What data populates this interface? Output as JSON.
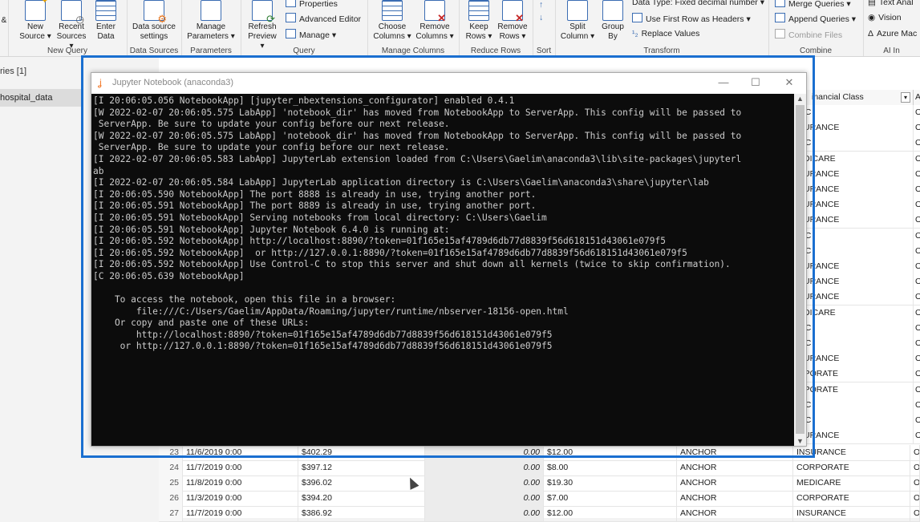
{
  "ribbon": {
    "groups": [
      {
        "label": "New Query",
        "buttons": [
          "New Source",
          "Recent Sources",
          "Enter Data"
        ]
      },
      {
        "label": "Data Sources",
        "buttons": [
          "Data source settings"
        ]
      },
      {
        "label": "Parameters",
        "buttons": [
          "Manage Parameters"
        ]
      },
      {
        "label": "Query",
        "buttons": [
          "Refresh Preview"
        ],
        "small": [
          "Properties",
          "Advanced Editor",
          "Manage"
        ]
      },
      {
        "label": "Manage Columns",
        "buttons": [
          "Choose Columns",
          "Remove Columns"
        ]
      },
      {
        "label": "Reduce Rows",
        "buttons": [
          "Keep Rows",
          "Remove Rows"
        ]
      },
      {
        "label": "Sort",
        "buttons": []
      },
      {
        "label": "Transform",
        "buttons": [
          "Split Column",
          "Group By"
        ],
        "small": [
          "Data Type: Fixed decimal number",
          "Use First Row as Headers",
          "Replace Values"
        ]
      },
      {
        "label": "Combine",
        "small": [
          "Merge Queries",
          "Append Queries",
          "Combine Files"
        ]
      },
      {
        "label": "AI In",
        "small": [
          "Text Anal",
          "Vision",
          "Azure Mac"
        ]
      }
    ],
    "edge_label": "&"
  },
  "queries": {
    "header": "ries [1]",
    "item": "hospital_data"
  },
  "window": {
    "title": "Jupyter Notebook (anaconda3)",
    "console": "[I 20:06:05.056 NotebookApp] [jupyter_nbextensions_configurator] enabled 0.4.1\n[W 2022-02-07 20:06:05.575 LabApp] 'notebook_dir' has moved from NotebookApp to ServerApp. This config will be passed to\n ServerApp. Be sure to update your config before our next release.\n[W 2022-02-07 20:06:05.575 LabApp] 'notebook_dir' has moved from NotebookApp to ServerApp. This config will be passed to\n ServerApp. Be sure to update your config before our next release.\n[I 2022-02-07 20:06:05.583 LabApp] JupyterLab extension loaded from C:\\Users\\Gaelim\\anaconda3\\lib\\site-packages\\jupyterl\nab\n[I 2022-02-07 20:06:05.584 LabApp] JupyterLab application directory is C:\\Users\\Gaelim\\anaconda3\\share\\jupyter\\lab\n[I 20:06:05.590 NotebookApp] The port 8888 is already in use, trying another port.\n[I 20:06:05.591 NotebookApp] The port 8889 is already in use, trying another port.\n[I 20:06:05.591 NotebookApp] Serving notebooks from local directory: C:\\Users\\Gaelim\n[I 20:06:05.591 NotebookApp] Jupyter Notebook 6.4.0 is running at:\n[I 20:06:05.592 NotebookApp] http://localhost:8890/?token=01f165e15af4789d6db77d8839f56d618151d43061e079f5\n[I 20:06:05.592 NotebookApp]  or http://127.0.0.1:8890/?token=01f165e15af4789d6db77d8839f56d618151d43061e079f5\n[I 20:06:05.592 NotebookApp] Use Control-C to stop this server and shut down all kernels (twice to skip confirmation).\n[C 20:06:05.639 NotebookApp]\n\n    To access the notebook, open this file in a browser:\n        file:///C:/Users/Gaelim/AppData/Roaming/jupyter/runtime/nbserver-18156-open.html\n    Or copy and paste one of these URLs:\n        http://localhost:8890/?token=01f165e15af4789d6db77d8839f56d618151d43061e079f5\n     or http://127.0.0.1:8890/?token=01f165e15af4789d6db77d8839f56d618151d43061e079f5",
    "minimize": "—",
    "maximize": "☐",
    "close": "✕"
  },
  "grid": {
    "right_header": "inancial Class",
    "right_classes": [
      "MC",
      "SURANCE",
      "MC",
      "EDICARE",
      "SURANCE",
      "SURANCE",
      "SURANCE",
      "SURANCE",
      "MC",
      "MC",
      "SURANCE",
      "SURANCE",
      "SURANCE",
      "EDICARE",
      "MC",
      "MC",
      "SURANCE",
      "RPORATE",
      "RPORATE",
      "MC",
      "MC",
      "SURANCE"
    ],
    "right_last": "O",
    "rows": [
      {
        "idx": "23",
        "date": "11/6/2019 0:00",
        "amount": "$402.29",
        "zero": "0.00",
        "amount2": "$12.00",
        "anchor": "ANCHOR",
        "cls": "INSURANCE",
        "last": "O"
      },
      {
        "idx": "24",
        "date": "11/7/2019 0:00",
        "amount": "$397.12",
        "zero": "0.00",
        "amount2": "$8.00",
        "anchor": "ANCHOR",
        "cls": "CORPORATE",
        "last": "O"
      },
      {
        "idx": "25",
        "date": "11/8/2019 0:00",
        "amount": "$396.02",
        "zero": "0.00",
        "amount2": "$19.30",
        "anchor": "ANCHOR",
        "cls": "MEDICARE",
        "last": "O"
      },
      {
        "idx": "26",
        "date": "11/3/2019 0:00",
        "amount": "$394.20",
        "zero": "0.00",
        "amount2": "$7.00",
        "anchor": "ANCHOR",
        "cls": "CORPORATE",
        "last": "O"
      },
      {
        "idx": "27",
        "date": "11/7/2019 0:00",
        "amount": "$386.92",
        "zero": "0.00",
        "amount2": "$12.00",
        "anchor": "ANCHOR",
        "cls": "INSURANCE",
        "last": "O"
      }
    ]
  },
  "colors": {
    "highlight": "#1a6fd0",
    "console_bg": "#0c0c0c",
    "console_fg": "#cccccc",
    "jupyter_orange": "#f37726"
  }
}
